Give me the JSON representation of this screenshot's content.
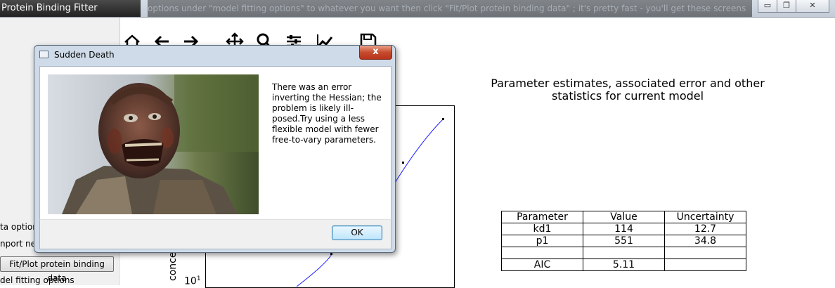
{
  "window": {
    "app_title": "Protein Binding Fitter",
    "title_overlay": "options under \"model fitting options\" to whatever you want then click \"Fit/Plot protein binding data\" ; it's pretty fast - you'll get these screens",
    "minimize_glyph": "▭",
    "restore_glyph": "❐",
    "close_glyph": "✕"
  },
  "sidebar": {
    "data_options_label": "ta options",
    "import_new_label": "nport new",
    "fit_button_label": "Fit/Plot protein binding data",
    "model_fitting_label": "del fitting options"
  },
  "toolbar": {
    "icons": [
      "home-icon",
      "back-arrow-icon",
      "forward-arrow-icon",
      "pan-icon",
      "zoom-icon",
      "configure-subplots-icon",
      "edit-axis-icon",
      "save-icon"
    ]
  },
  "plot": {
    "y_axis_label": "conce",
    "y_tick_base": "10",
    "y_tick_exp": "1",
    "curve_color": "#2020ff"
  },
  "stats": {
    "title_line1": "Parameter estimates, associated error and other",
    "title_line2": "statistics for current model",
    "header": [
      "Parameter",
      "Value",
      "Uncertainty"
    ],
    "rows": [
      [
        "kd1",
        "114",
        "12.7"
      ],
      [
        "p1",
        "551",
        "34.8"
      ],
      [
        "",
        "",
        ""
      ],
      [
        "AIC",
        "5.11",
        ""
      ]
    ]
  },
  "dialog": {
    "title": "Sudden Death",
    "close_glyph": "x",
    "message": "There was an error inverting the Hessian; the problem is likely ill-posed.Try using a less flexible model with fewer free-to-vary parameters.",
    "ok_label": "OK"
  }
}
